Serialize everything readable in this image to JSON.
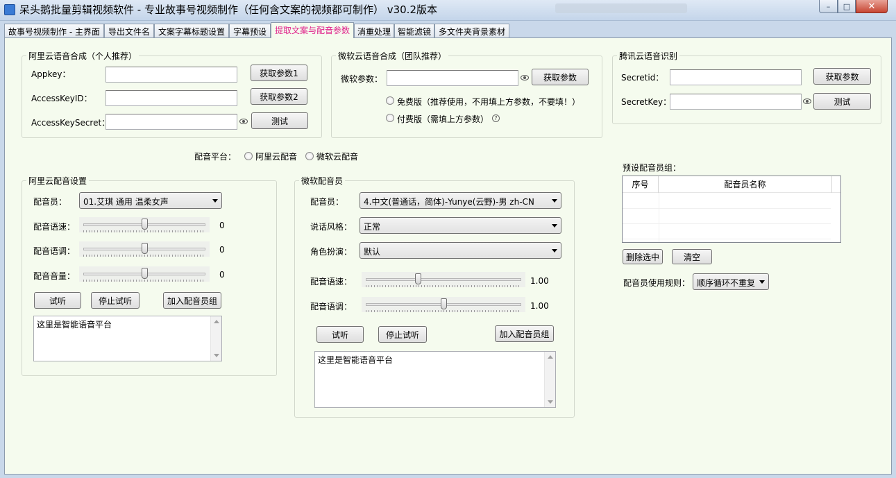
{
  "window": {
    "title": "呆头鹅批量剪辑视频软件 -  专业故事号视频制作（任何含文案的视频都可制作）  v30.2版本",
    "minimize_glyph": "–",
    "maximize_glyph": "□",
    "close_glyph": "✕"
  },
  "tabs": [
    {
      "label": "故事号视频制作 - 主界面",
      "active": false
    },
    {
      "label": "导出文件名",
      "active": false
    },
    {
      "label": "文案字幕标题设置",
      "active": false
    },
    {
      "label": "字幕预设",
      "active": false
    },
    {
      "label": "提取文案与配音参数",
      "active": true
    },
    {
      "label": "消重处理",
      "active": false
    },
    {
      "label": "智能滤镜",
      "active": false
    },
    {
      "label": "多文件夹背景素材",
      "active": false
    }
  ],
  "aliyun_tts": {
    "title": "阿里云语音合成（个人推荐）",
    "appkey_label": "Appkey：",
    "appkey_value": "",
    "accesskeyid_label": "AccessKeyID：",
    "accesskeyid_value": "",
    "secret_label": "AccessKeySecret：",
    "secret_value": "",
    "get_param1": "获取参数1",
    "get_param2": "获取参数2",
    "test": "测试"
  },
  "ms_tts": {
    "title": "微软云语音合成（团队推荐）",
    "param_label": "微软参数：",
    "param_value": "",
    "get_param": "获取参数",
    "free_option": "免费版（推荐使用，不用填上方参数，不要填！）",
    "paid_option": "付费版（需填上方参数）",
    "help_glyph": "?"
  },
  "tencent_asr": {
    "title": "腾讯云语音识别",
    "secretid_label": "Secretid：",
    "secretid_value": "",
    "secretkey_label": "SecretKey：",
    "secretkey_value": "",
    "get_param": "获取参数",
    "test": "测试"
  },
  "platform": {
    "label": "配音平台：",
    "option_aliyun": "阿里云配音",
    "option_ms": "微软云配音"
  },
  "aliyun_voice": {
    "title": "阿里云配音设置",
    "voice_label": "配音员：",
    "voice_value": "01.艾琪 通用 温柔女声",
    "speed_label": "配音语速：",
    "speed_value": "0",
    "speed_level": 0.5,
    "pitch_label": "配音语调：",
    "pitch_value": "0",
    "pitch_level": 0.5,
    "volume_label": "配音音量：",
    "volume_value": "0",
    "volume_level": 0.5,
    "listen": "试听",
    "stop": "停止试听",
    "add_group": "加入配音员组",
    "text": "这里是智能语音平台"
  },
  "ms_voice": {
    "title": "微软配音员",
    "voice_label": "配音员：",
    "voice_value": "4.中文(普通话，简体)-Yunye(云野)-男 zh-CN",
    "style_label": "说话风格：",
    "style_value": "正常",
    "role_label": "角色扮演：",
    "role_value": "默认",
    "speed_label": "配音语速：",
    "speed_value": "1.00",
    "speed_level": 0.33,
    "pitch_label": "配音语调：",
    "pitch_value": "1.00",
    "pitch_level": 0.5,
    "listen": "试听",
    "stop": "停止试听",
    "add_group": "加入配音员组",
    "text": "这里是智能语音平台"
  },
  "preset_group": {
    "title": "预设配音员组：",
    "columns": [
      "序号",
      "配音员名称"
    ],
    "rows": [],
    "delete": "删除选中",
    "clear": "清空",
    "rule_label": "配音员使用规则：",
    "rule_value": "顺序循环不重复"
  }
}
